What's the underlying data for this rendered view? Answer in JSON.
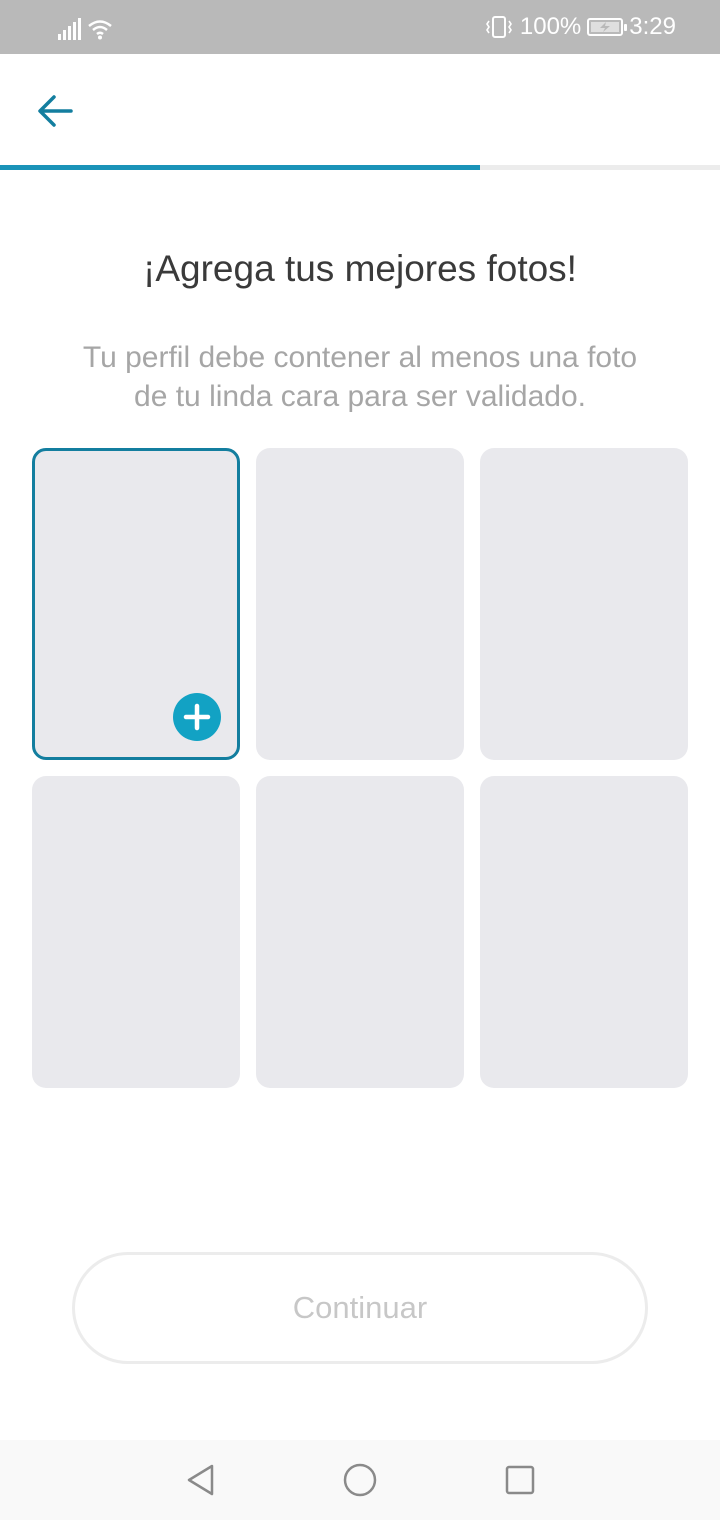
{
  "status_bar": {
    "battery_text": "100%",
    "time": "3:29",
    "icons": [
      "signal-icon",
      "wifi-icon",
      "vibrate-icon",
      "battery-charging-icon"
    ]
  },
  "header": {
    "back_icon": "arrow-left-icon",
    "progress_fraction": 0.667
  },
  "content": {
    "title": "¡Agrega tus mejores fotos!",
    "subtitle": "Tu perfil debe contener al menos una foto de tu linda cara para ser validado."
  },
  "photo_slots": [
    {
      "state": "selected",
      "add_icon": "plus-circle-icon"
    },
    {
      "state": "empty"
    },
    {
      "state": "empty"
    },
    {
      "state": "empty"
    },
    {
      "state": "empty"
    },
    {
      "state": "empty"
    }
  ],
  "actions": {
    "continue_label": "Continuar"
  },
  "navigation_bar": {
    "icons": [
      "back-triangle-icon",
      "home-circle-icon",
      "recents-square-icon"
    ]
  },
  "colors": {
    "accent": "#1a93b8",
    "selected_border": "#137e9f",
    "add_button": "#12a2c4",
    "slot_background": "#e9e9ed"
  }
}
